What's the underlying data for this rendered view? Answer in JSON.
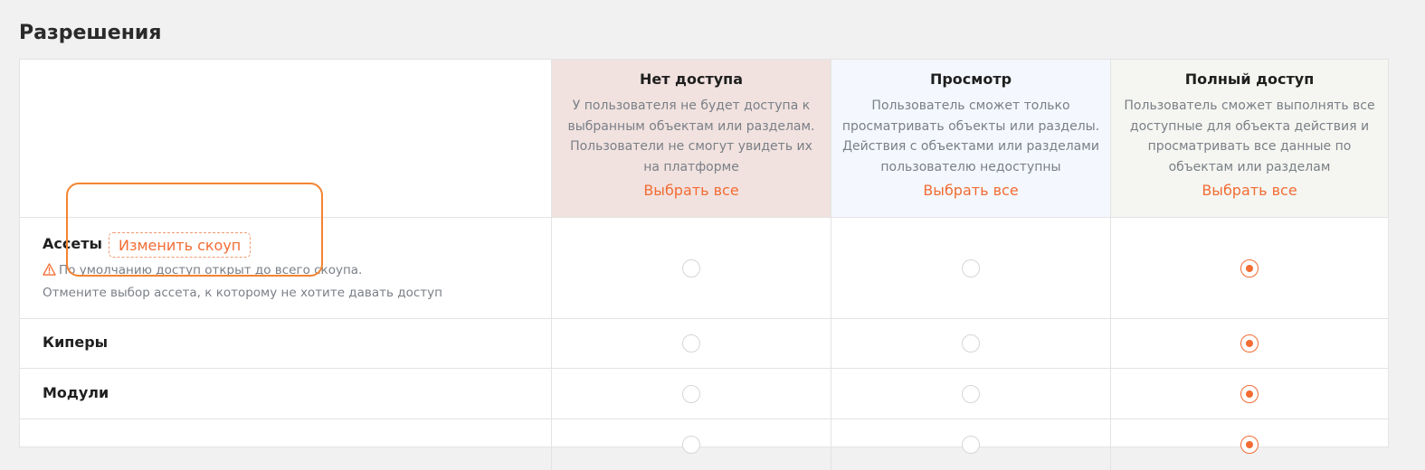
{
  "page": {
    "title": "Разрешения"
  },
  "columns": [
    {
      "title": "Нет доступа",
      "description": "У пользователя не будет доступа к выбранным объектам или разделам. Пользователи не смогут увидеть их на платформе",
      "select_all": "Выбрать все",
      "color": "#f1e2df"
    },
    {
      "title": "Просмотр",
      "description": "Пользователь сможет только просматривать объекты или разделы. Действия с объектами или разделами пользователю недоступны",
      "select_all": "Выбрать все",
      "color": "#f4f7fd"
    },
    {
      "title": "Полный доступ",
      "description": "Пользователь сможет выполнять все доступные для объекта действия и просматривать все данные по объектам или разделам",
      "select_all": "Выбрать все",
      "color": "#f5f6f1"
    }
  ],
  "rows": [
    {
      "label": "Ассеты",
      "scope_button": "Изменить скоуп",
      "hint_line1": "По умолчанию доступ открыт до всего скоупа.",
      "hint_line2": "Отмените выбор ассета, к которому не хотите давать доступ",
      "selected": "Полный доступ"
    },
    {
      "label": "Киперы",
      "selected": "Полный доступ"
    },
    {
      "label": "Модули",
      "selected": "Полный доступ"
    },
    {
      "label": "",
      "selected": "Полный доступ"
    }
  ],
  "icons": {
    "warning": "warning-icon"
  },
  "colors": {
    "accent": "#f26c34",
    "highlight": "#f48430"
  }
}
